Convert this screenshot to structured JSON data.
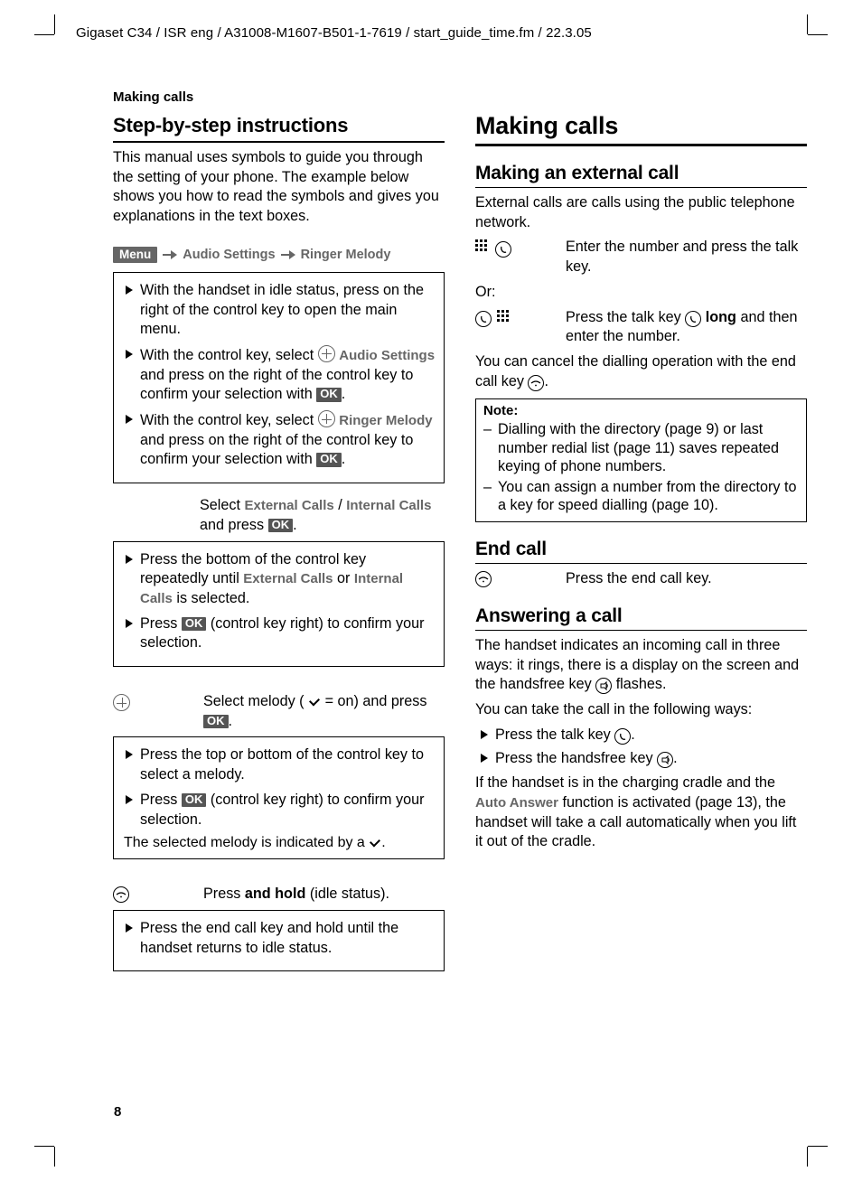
{
  "header_line": "Gigaset C34 / ISR eng / A31008-M1607-B501-1-7619 / start_guide_time.fm / 22.3.05",
  "running_head": "Making calls",
  "page_number": "8",
  "left": {
    "h2_step": "Step-by-step instructions",
    "intro": "This manual uses symbols to guide you through the setting of your phone. The example below shows you how to read the symbols and gives you explanations in the text boxes.",
    "menu_label": "Menu",
    "menu_path_1": "Audio Settings",
    "menu_path_2": "Ringer Melody",
    "box1": {
      "i1a": "With the handset in idle status, press on the right of the control key to open the main menu.",
      "i2a": "With the control key, select ",
      "i2b": "Audio Settings",
      "i2c": " and press on the right of the control key to confirm your selection with ",
      "i3a": "With the control key, select ",
      "i3b": "Ringer Melody",
      "i3c": " and press on the right of the control key to confirm your selection with "
    },
    "between1a": "Select ",
    "between1b": "External Calls",
    "between1c": " / ",
    "between1d": "Internal Calls",
    "between1e": " and press ",
    "box2": {
      "i1a": "Press the bottom of the control key repeatedly until ",
      "i1b": "External Calls",
      "i1c": " or ",
      "i1d": "Internal Calls",
      "i1e": " is selected.",
      "i2a": "Press ",
      "i2b": " (control key right) to confirm your selection."
    },
    "between2a": "Select melody (",
    "between2b": " = on) and press ",
    "box3": {
      "i1": "Press the top or bottom of the control key to select a melody.",
      "i2a": "Press ",
      "i2b": " (control key right) to confirm your selection.",
      "foot": "The selected melody is indicated by a "
    },
    "between3a": "Press ",
    "between3b": "and hold",
    "between3c": " (idle status).",
    "box4": {
      "i1": "Press the end call key and hold until the handset returns to idle status."
    }
  },
  "right": {
    "h1": "Making calls",
    "h3_ext": "Making an external call",
    "ext_intro": "External calls are calls using the public telephone network.",
    "ext_step1": "Enter the number and press the talk key.",
    "or": "Or:",
    "ext_step2a": "Press the talk key ",
    "ext_step2b": "long",
    "ext_step2c": " and then enter the number.",
    "cancel": "You can cancel the dialling operation with the end call key ",
    "note_title": "Note:",
    "note1": "Dialling with the directory (page 9) or last number redial list (page 11) saves repeated keying of phone numbers.",
    "note2": "You can assign a number from the directory to a key for speed dialling (page 10).",
    "h3_end": "End call",
    "end_text": "Press the end call key.",
    "h3_answer": "Answering a call",
    "ans_p1a": "The handset indicates an incoming call in three ways: it rings, there is a display on the screen and the handsfree key ",
    "ans_p1b": " flashes.",
    "ans_p2": "You can take the call in the following ways:",
    "ans_b1": "Press the talk key ",
    "ans_b2": "Press the handsfree key ",
    "ans_p3a": "If the handset is in the charging cradle and the ",
    "ans_p3b": "Auto Answer",
    "ans_p3c": " function is activated (page 13), the handset will take a call automatically when you lift it out of the cradle."
  }
}
